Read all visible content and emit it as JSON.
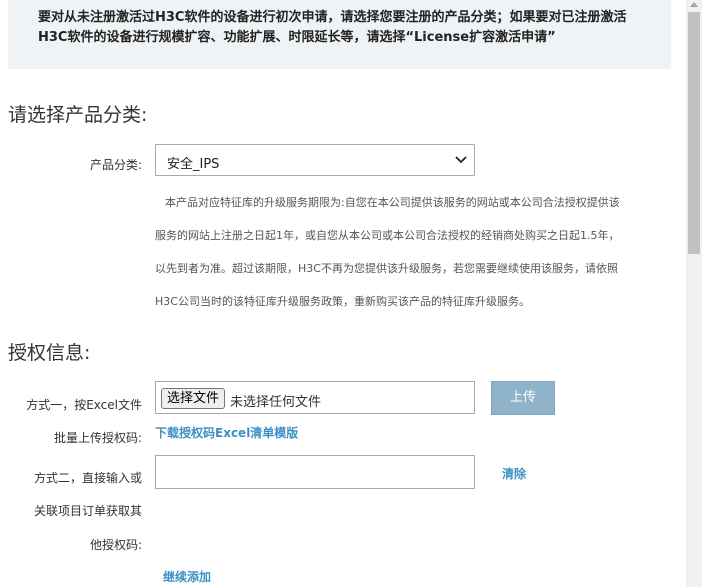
{
  "notice": {
    "line1": "要对从未注册激活过H3C软件的设备进行初次申请，请选择您要注册的产品分类；如果要对已注册激活",
    "line2": "H3C软件的设备进行规模扩容、功能扩展、时限延长等，请选择“License扩容激活申请”"
  },
  "product_section": {
    "title": "请选择产品分类:",
    "category_label": "产品分类:",
    "category_value": "安全_IPS",
    "description_lines": [
      "本产品对应特征库的升级服务期限为:自您在本公司提供该服务的网站或本公司合法授权提供该",
      "服务的网站上注册之日起1年，或自您从本公司或本公司合法授权的经销商处购买之日起1.5年，",
      "以先到者为准。超过该期限，H3C不再为您提供该升级服务，若您需要继续使用该服务，请依照",
      "H3C公司当时的该特征库升级服务政策，重新购买该产品的特征库升级服务。"
    ]
  },
  "auth_section": {
    "title": "授权信息:",
    "method1_label_line1": "方式一，按Excel文件",
    "method1_label_line2": "批量上传授权码:",
    "choose_file_label": "选择文件",
    "file_status": "未选择任何文件",
    "upload_label": "上传",
    "download_template_label": "下载授权码Excel清单模版",
    "method2_label_line1": "方式二，直接输入或",
    "method2_label_line2": "关联项目订单获取其",
    "method2_label_line3": "他授权码:",
    "code_input_value": "",
    "clear_label": "清除",
    "continue_add_label": "继续添加"
  }
}
